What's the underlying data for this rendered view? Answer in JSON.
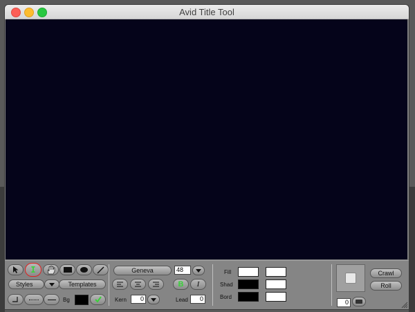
{
  "window": {
    "title": "Avid Title Tool"
  },
  "tools": {
    "select": "selection-arrow",
    "text": "I",
    "hand": "hand",
    "rect": "rectangle",
    "oval": "oval",
    "line": "line"
  },
  "styles_label": "Styles",
  "templates_label": "Templates",
  "bg_label": "Bg",
  "font": {
    "name": "Geneva",
    "size": "48"
  },
  "bold_label": "B",
  "italic_label": "I",
  "kern": {
    "label": "Kern",
    "value": "0"
  },
  "lead": {
    "label": "Lead",
    "value": "0"
  },
  "colors": {
    "fill_label": "Fill",
    "shad_label": "Shad",
    "bord_label": "Bord",
    "canvas": "#05041a",
    "accent_green": "#3ad13a",
    "highlight_red": "#e02020"
  },
  "preview_value": "0",
  "crawl_label": "Crawl",
  "roll_label": "Roll"
}
